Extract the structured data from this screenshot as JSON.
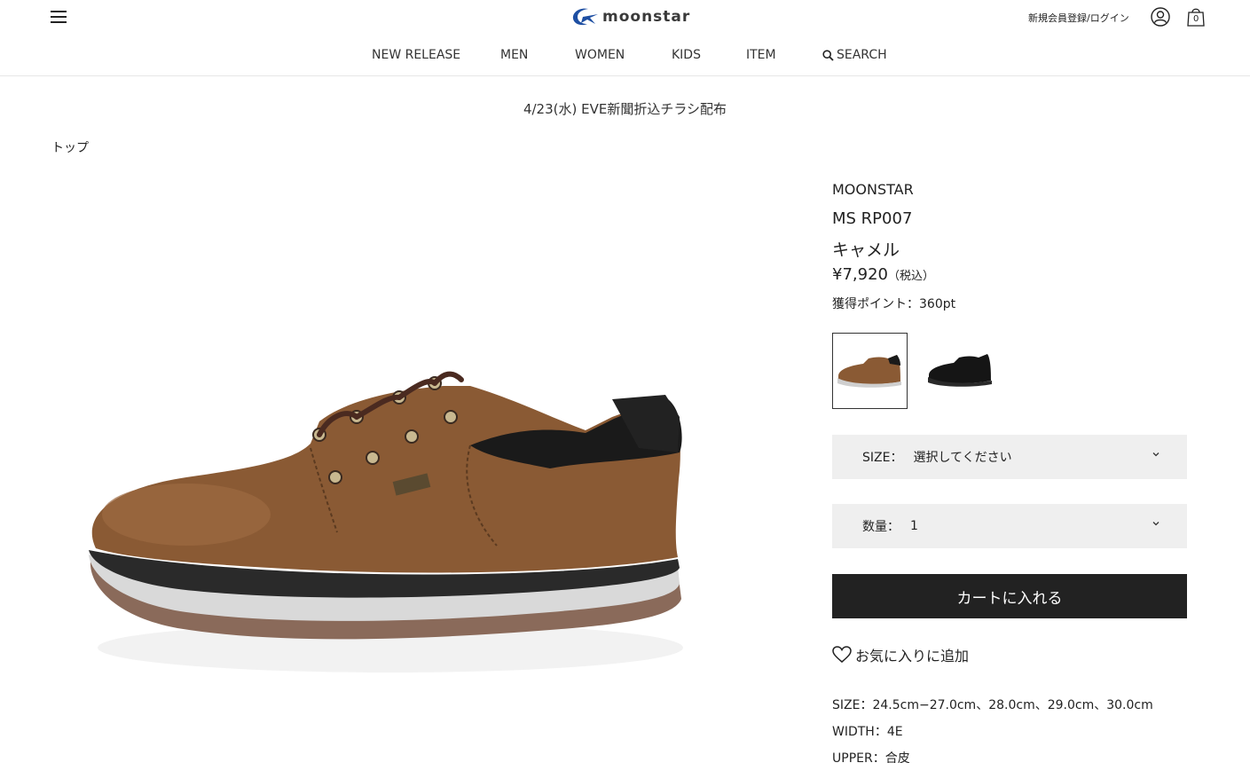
{
  "header": {
    "logo_text": "moonstar",
    "login": "新規会員登録/ログイン",
    "cart_count": "0"
  },
  "nav": {
    "items": [
      "NEW RELEASE",
      "MEN",
      "WOMEN",
      "KIDS",
      "ITEM"
    ],
    "search_label": "SEARCH"
  },
  "notice": "4/23(水) EVE新聞折込チラシ配布",
  "breadcrumb": "トップ",
  "product": {
    "brand": "MOONSTAR",
    "model": "MS RP007",
    "color": "キャメル",
    "price": "¥7,920",
    "tax": "（税込）",
    "points": "獲得ポイント：360pt",
    "swatches": [
      "camel",
      "black"
    ],
    "size_label": "SIZE：",
    "size_value": "選択してください",
    "qty_label": "数量：",
    "qty_value": "1",
    "cart_button": "カートに入れる",
    "favorite": "お気に入りに追加",
    "specs": [
      "SIZE：24.5cm−27.0cm、28.0cm、29.0cm、30.0cm",
      "WIDTH：4E",
      "UPPER：合皮"
    ]
  },
  "colors": {
    "primary_dark": "#222222",
    "select_bg": "#efefef",
    "logo_blue": "#1e4fa3",
    "shoe_brown": "#8a5a34"
  }
}
